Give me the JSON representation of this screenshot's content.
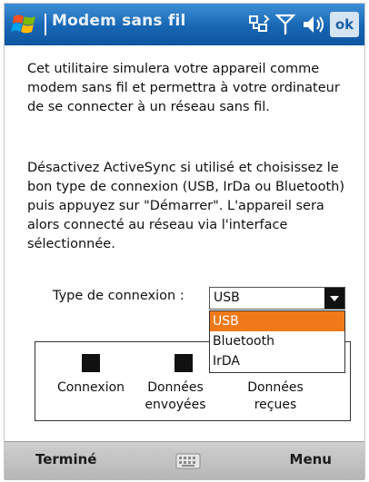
{
  "titlebar": {
    "title": "Modem sans fil",
    "ok_label": "ok",
    "icons": [
      "windows-flag-icon",
      "connectivity-icon",
      "signal-icon",
      "volume-icon"
    ]
  },
  "content": {
    "paragraph1": "Cet utilitaire simulera votre appareil comme modem sans fil et permettra à votre ordinateur de se connecter à un réseau sans fil.",
    "paragraph2": "Désactivez ActiveSync si utilisé et choisissez le bon type de connexion (USB, IrDa ou Bluetooth) puis appuyez sur \"Démarrer\". L'appareil sera alors connecté au réseau via l'interface sélectionnée."
  },
  "connection": {
    "label": "Type de connexion :",
    "selected": "USB",
    "options": [
      "USB",
      "Bluetooth",
      "IrDA"
    ],
    "selected_index": 0
  },
  "status": {
    "connexion": "Connexion",
    "sent_line1": "Données",
    "sent_line2": "envoyées",
    "received_line1": "Données",
    "received_line2": "reçues"
  },
  "softkeys": {
    "left": "Terminé",
    "right": "Menu"
  },
  "colors": {
    "titlebar": "#1766b3",
    "selection": "#f07a1a",
    "softkey_bar": "#c4c4c4"
  }
}
